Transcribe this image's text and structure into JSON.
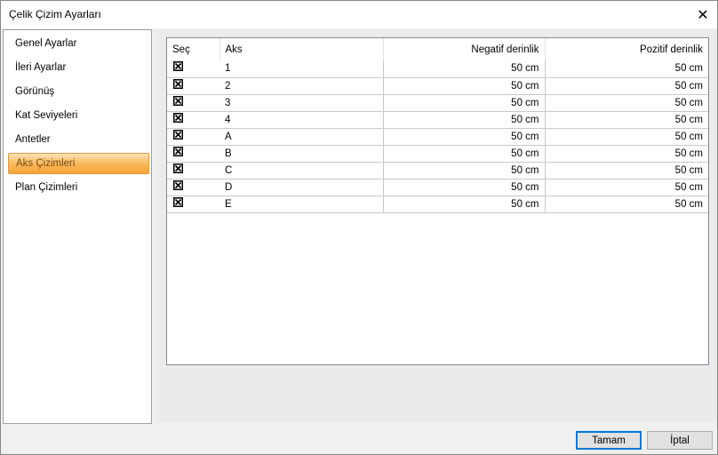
{
  "window": {
    "title": "Çelik Çizim Ayarları",
    "close_icon": "close-icon"
  },
  "sidebar": {
    "items": [
      {
        "label": "Genel Ayarlar",
        "active": false
      },
      {
        "label": "İleri Ayarlar",
        "active": false
      },
      {
        "label": "Görünüş",
        "active": false
      },
      {
        "label": "Kat Seviyeleri",
        "active": false
      },
      {
        "label": "Antetler",
        "active": false
      },
      {
        "label": "Aks Çizimleri",
        "active": true
      },
      {
        "label": "Plan Çizimleri",
        "active": false
      }
    ]
  },
  "table": {
    "headers": [
      "Seç",
      "Aks",
      "Negatif derinlik",
      "Pozitif derinlik"
    ],
    "rows": [
      {
        "checked": true,
        "aks": "1",
        "neg": "50 cm",
        "poz": "50 cm"
      },
      {
        "checked": true,
        "aks": "2",
        "neg": "50 cm",
        "poz": "50 cm"
      },
      {
        "checked": true,
        "aks": "3",
        "neg": "50 cm",
        "poz": "50 cm"
      },
      {
        "checked": true,
        "aks": "4",
        "neg": "50 cm",
        "poz": "50 cm"
      },
      {
        "checked": true,
        "aks": "A",
        "neg": "50 cm",
        "poz": "50 cm"
      },
      {
        "checked": true,
        "aks": "B",
        "neg": "50 cm",
        "poz": "50 cm"
      },
      {
        "checked": true,
        "aks": "C",
        "neg": "50 cm",
        "poz": "50 cm"
      },
      {
        "checked": true,
        "aks": "D",
        "neg": "50 cm",
        "poz": "50 cm"
      },
      {
        "checked": true,
        "aks": "E",
        "neg": "50 cm",
        "poz": "50 cm"
      }
    ]
  },
  "buttons": {
    "ok": "Tamam",
    "cancel": "İptal"
  }
}
